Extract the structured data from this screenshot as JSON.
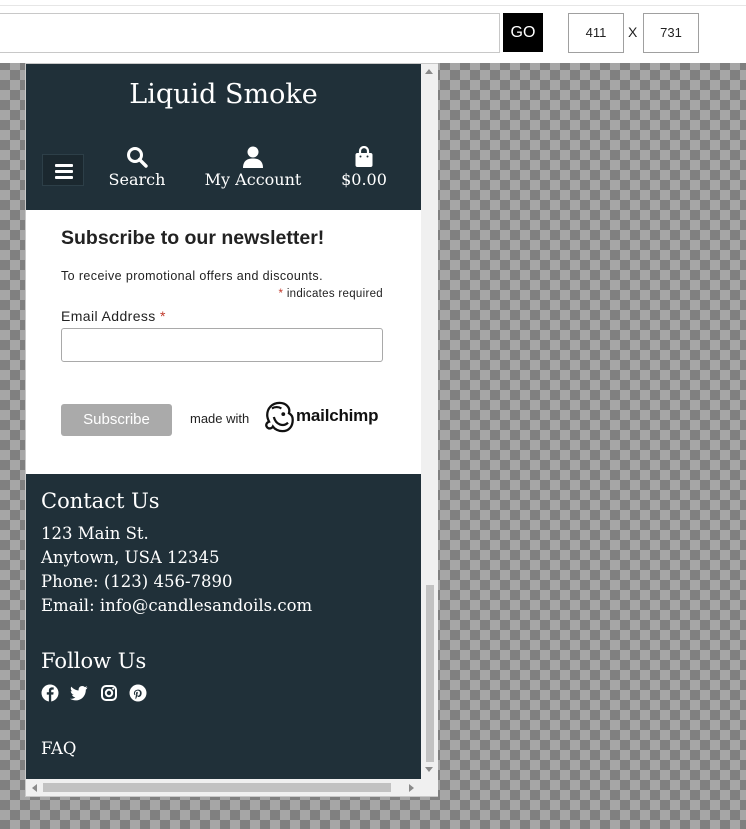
{
  "toolbar": {
    "go_label": "GO",
    "width_value": "411",
    "height_value": "731",
    "separator": "X"
  },
  "site": {
    "brand": "Liquid Smoke",
    "nav": {
      "search_label": "Search",
      "account_label": "My Account",
      "cart_total": "$0.00"
    }
  },
  "newsletter": {
    "title": "Subscribe to our newsletter!",
    "description": "To receive promotional offers and discounts.",
    "required_asterisk": "*",
    "required_note": "indicates required",
    "email_label": "Email Address",
    "subscribe_label": "Subscribe",
    "made_with": "made with",
    "mailchimp": "mailchimp"
  },
  "footer": {
    "contact_title": "Contact Us",
    "address_line1": "123 Main St.",
    "address_line2": "Anytown, USA 12345",
    "phone": "Phone: (123) 456-7890",
    "email": "Email: info@candlesandoils.com",
    "follow_title": "Follow Us",
    "social_icons": [
      "facebook-icon",
      "twitter-icon",
      "instagram-icon",
      "pinterest-icon"
    ],
    "faq_label": "FAQ"
  },
  "colors": {
    "header_bg": "#203039",
    "go_button": "#000000",
    "subscribe_button": "#aaaaaa",
    "required_asterisk": "#c0392b"
  }
}
